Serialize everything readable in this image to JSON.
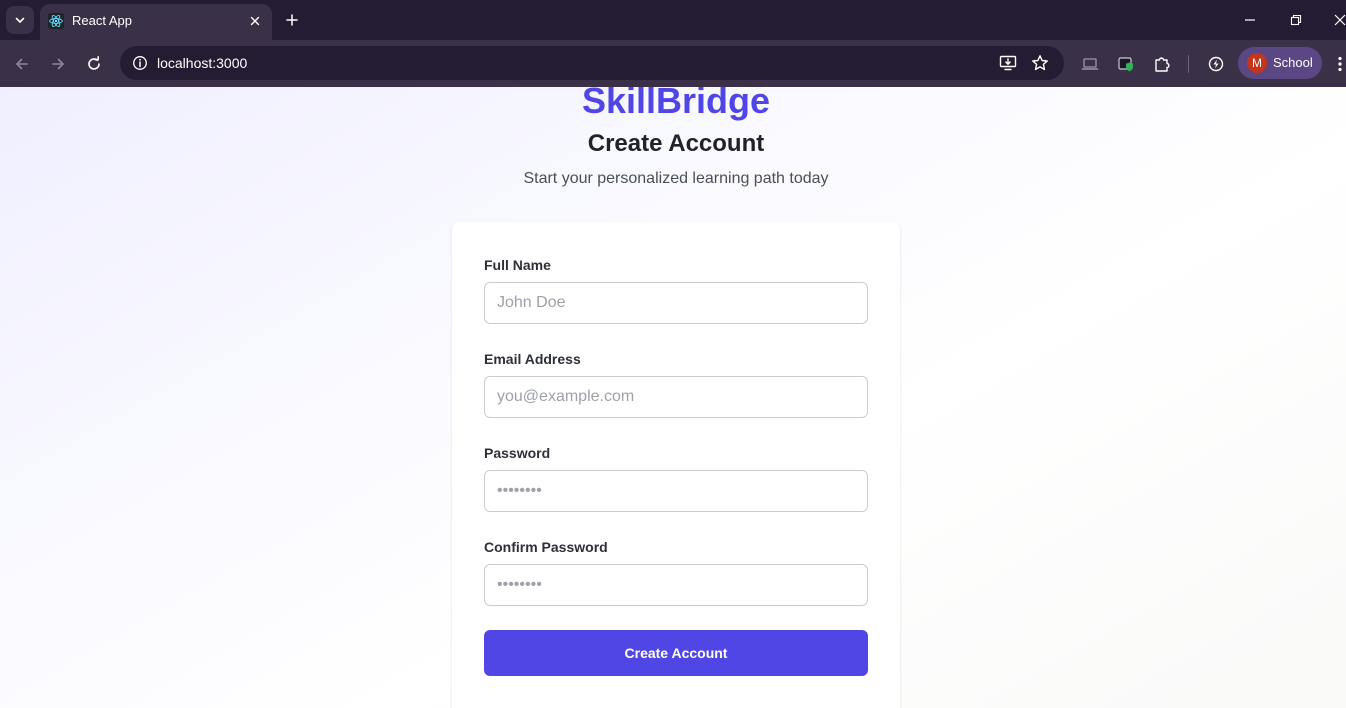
{
  "browser": {
    "tab": {
      "title": "React App"
    },
    "address_bar": {
      "url": "localhost:3000"
    },
    "profile": {
      "initial": "M",
      "label": "School"
    }
  },
  "page": {
    "brand": "SkillBridge",
    "heading": "Create Account",
    "subtitle": "Start your personalized learning path today",
    "form": {
      "full_name": {
        "label": "Full Name",
        "value": "",
        "placeholder": "John Doe"
      },
      "email": {
        "label": "Email Address",
        "value": "",
        "placeholder": "you@example.com"
      },
      "password": {
        "label": "Password",
        "value": "",
        "placeholder": "••••••••"
      },
      "confirm_password": {
        "label": "Confirm Password",
        "value": "",
        "placeholder": "••••••••"
      },
      "submit_label": "Create Account"
    }
  },
  "colors": {
    "accent": "#4f46e5",
    "chrome_dark": "#241c33",
    "chrome_toolbar": "#3a3148",
    "avatar": "#c4351a"
  }
}
